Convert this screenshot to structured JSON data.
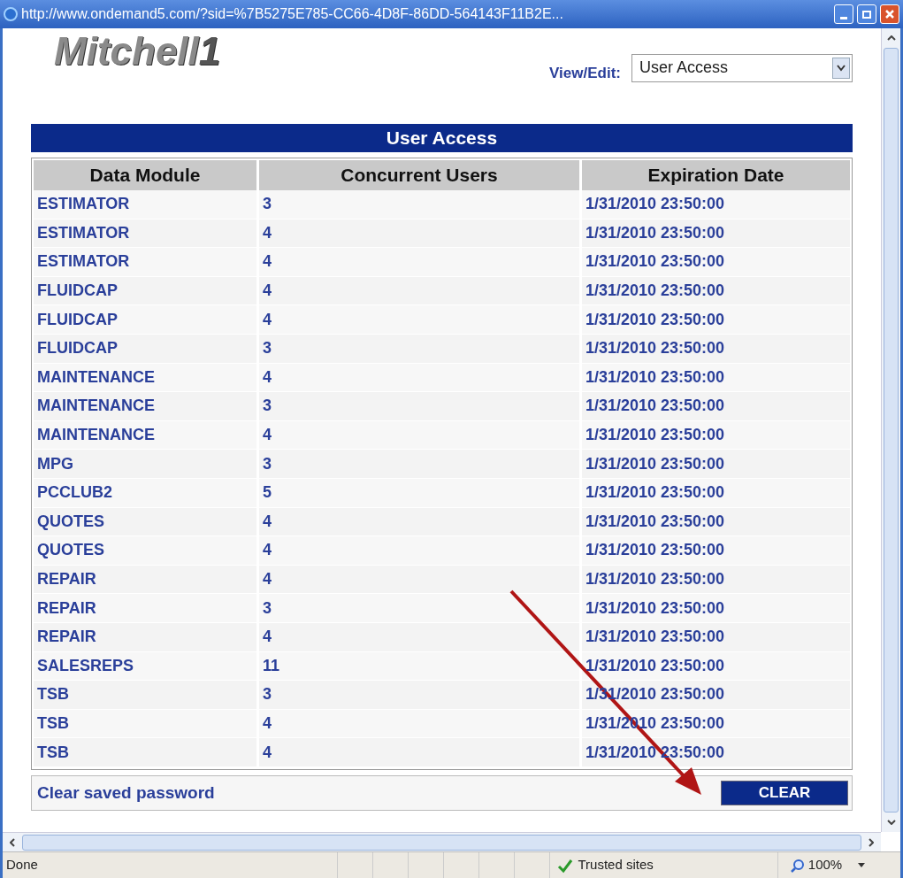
{
  "window": {
    "title": "http://www.ondemand5.com/?sid=%7B5275E785-CC66-4D8F-86DD-564143F11B2E..."
  },
  "logo": {
    "text": "Mitchell",
    "mark": "1"
  },
  "view_edit": {
    "label": "View/Edit:",
    "value": "User Access"
  },
  "table": {
    "title": "User Access",
    "columns": [
      "Data Module",
      "Concurrent Users",
      "Expiration Date"
    ],
    "rows": [
      [
        "ESTIMATOR",
        "3",
        "1/31/2010 23:50:00"
      ],
      [
        "ESTIMATOR",
        "4",
        "1/31/2010 23:50:00"
      ],
      [
        "ESTIMATOR",
        "4",
        "1/31/2010 23:50:00"
      ],
      [
        "FLUIDCAP",
        "4",
        "1/31/2010 23:50:00"
      ],
      [
        "FLUIDCAP",
        "4",
        "1/31/2010 23:50:00"
      ],
      [
        "FLUIDCAP",
        "3",
        "1/31/2010 23:50:00"
      ],
      [
        "MAINTENANCE",
        "4",
        "1/31/2010 23:50:00"
      ],
      [
        "MAINTENANCE",
        "3",
        "1/31/2010 23:50:00"
      ],
      [
        "MAINTENANCE",
        "4",
        "1/31/2010 23:50:00"
      ],
      [
        "MPG",
        "3",
        "1/31/2010 23:50:00"
      ],
      [
        "PCCLUB2",
        "5",
        "1/31/2010 23:50:00"
      ],
      [
        "QUOTES",
        "4",
        "1/31/2010 23:50:00"
      ],
      [
        "QUOTES",
        "4",
        "1/31/2010 23:50:00"
      ],
      [
        "REPAIR",
        "4",
        "1/31/2010 23:50:00"
      ],
      [
        "REPAIR",
        "3",
        "1/31/2010 23:50:00"
      ],
      [
        "REPAIR",
        "4",
        "1/31/2010 23:50:00"
      ],
      [
        "SALESREPS",
        "11",
        "1/31/2010 23:50:00"
      ],
      [
        "TSB",
        "3",
        "1/31/2010 23:50:00"
      ],
      [
        "TSB",
        "4",
        "1/31/2010 23:50:00"
      ],
      [
        "TSB",
        "4",
        "1/31/2010 23:50:00"
      ]
    ]
  },
  "clear_row": {
    "label": "Clear saved password",
    "button": "CLEAR"
  },
  "status_bar": {
    "status": "Done",
    "zone": "Trusted sites",
    "zoom": "100%"
  }
}
